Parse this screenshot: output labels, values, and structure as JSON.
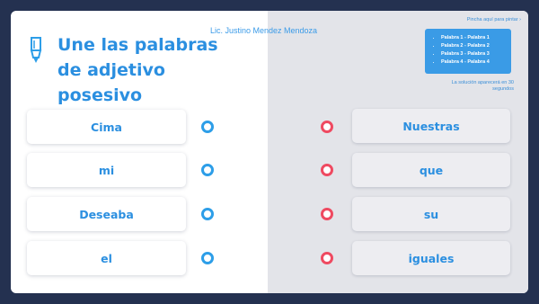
{
  "title": "Une las palabras de adjetivo posesivo",
  "author": "Lic. Justino Mendez Mendoza",
  "hint": {
    "label": "Pincha aquí para pintar ›",
    "items": [
      "Palabra 1 - Palabra 1",
      "Palabra 2 - Palabra 2",
      "Palabra 3 - Palabra 3",
      "Palabra 4 - Palabra 4"
    ],
    "solution_text": "La solución aparecerá en 30 segundos"
  },
  "left_words": [
    "Cima",
    "mi",
    "Deseaba",
    "el"
  ],
  "right_words": [
    "Nuestras",
    "que",
    "su",
    "iguales"
  ],
  "colors": {
    "background": "#243150",
    "accent_blue": "#2b8fe0",
    "dot_blue": "#2d9ee8",
    "dot_red": "#ef4a61",
    "right_panel": "#e3e4e9"
  },
  "icons": [
    "pencil-icon"
  ]
}
